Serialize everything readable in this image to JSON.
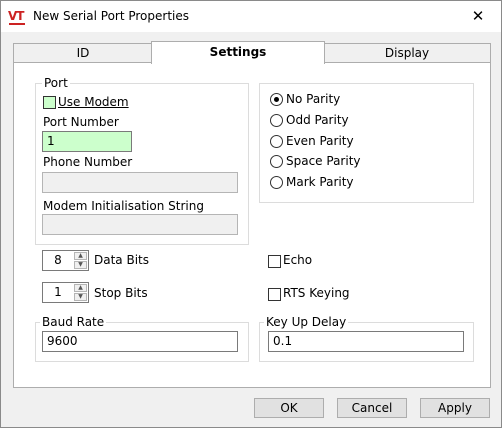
{
  "window": {
    "title": "New Serial Port Properties",
    "close_glyph": "✕",
    "app_icon": "VT"
  },
  "tabs": [
    {
      "label": "ID"
    },
    {
      "label": "Settings"
    },
    {
      "label": "Display"
    }
  ],
  "port": {
    "group_title": "Port",
    "use_modem_label": "Use Modem",
    "use_modem_checked": false,
    "port_number_label": "Port Number",
    "port_number_value": "1",
    "phone_number_label": "Phone Number",
    "phone_number_value": "",
    "modem_init_label": "Modem Initialisation String",
    "modem_init_value": ""
  },
  "parity": {
    "selected": "No Parity",
    "options": [
      "No Parity",
      "Odd Parity",
      "Even Parity",
      "Space Parity",
      "Mark Parity"
    ]
  },
  "data_bits": {
    "value": "8",
    "label": "Data Bits"
  },
  "stop_bits": {
    "value": "1",
    "label": "Stop Bits"
  },
  "echo": {
    "label": "Echo",
    "checked": false
  },
  "rts_keying": {
    "label": "RTS Keying",
    "checked": false
  },
  "baud_rate": {
    "label": "Baud Rate",
    "value": "9600"
  },
  "key_up_delay": {
    "label": "Key Up Delay",
    "value": "0.1"
  },
  "buttons": {
    "ok": "OK",
    "cancel": "Cancel",
    "apply": "Apply"
  },
  "colors": {
    "highlight_green": "#ccffcc"
  }
}
